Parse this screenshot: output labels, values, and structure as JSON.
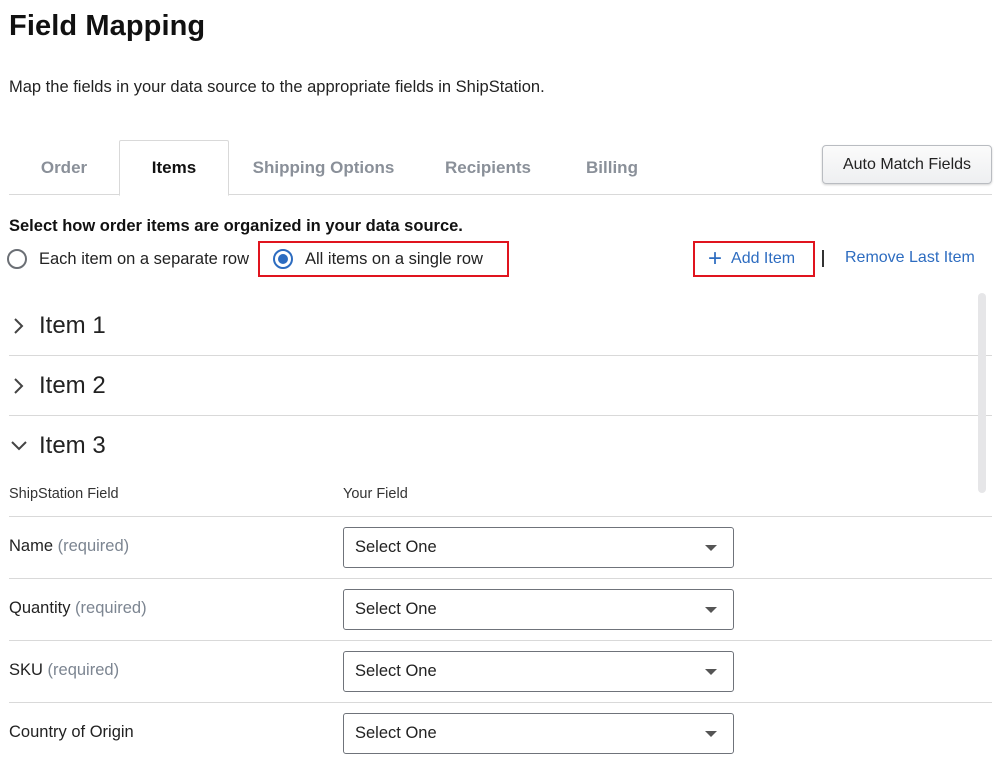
{
  "header": {
    "title": "Field Mapping",
    "subtitle": "Map the fields in your data source to the appropriate fields in ShipStation."
  },
  "tabs": [
    {
      "label": "Order",
      "active": false
    },
    {
      "label": "Items",
      "active": true
    },
    {
      "label": "Shipping Options",
      "active": false
    },
    {
      "label": "Recipients",
      "active": false
    },
    {
      "label": "Billing",
      "active": false
    }
  ],
  "auto_match_label": "Auto Match Fields",
  "items_section": {
    "prompt": "Select how order items are organized in your data source.",
    "radio_options": [
      {
        "label": "Each item on a separate row",
        "selected": false
      },
      {
        "label": "All items on a single row",
        "selected": true
      }
    ],
    "add_item_label": "Add Item",
    "remove_last_label": "Remove Last Item"
  },
  "accordions": [
    {
      "label": "Item 1",
      "expanded": false
    },
    {
      "label": "Item 2",
      "expanded": false
    },
    {
      "label": "Item 3",
      "expanded": true
    }
  ],
  "mapping_table": {
    "columns": [
      "ShipStation Field",
      "Your Field"
    ],
    "rows": [
      {
        "field": "Name",
        "qualifier": "(required)",
        "value": "Select One"
      },
      {
        "field": "Quantity",
        "qualifier": "(required)",
        "value": "Select One"
      },
      {
        "field": "SKU",
        "qualifier": "(required)",
        "value": "Select One"
      },
      {
        "field": "Country of Origin",
        "qualifier": "",
        "value": "Select One"
      }
    ]
  },
  "colors": {
    "link": "#2d6cc0",
    "highlight": "#e0141e",
    "muted_tab": "#8a9099"
  }
}
